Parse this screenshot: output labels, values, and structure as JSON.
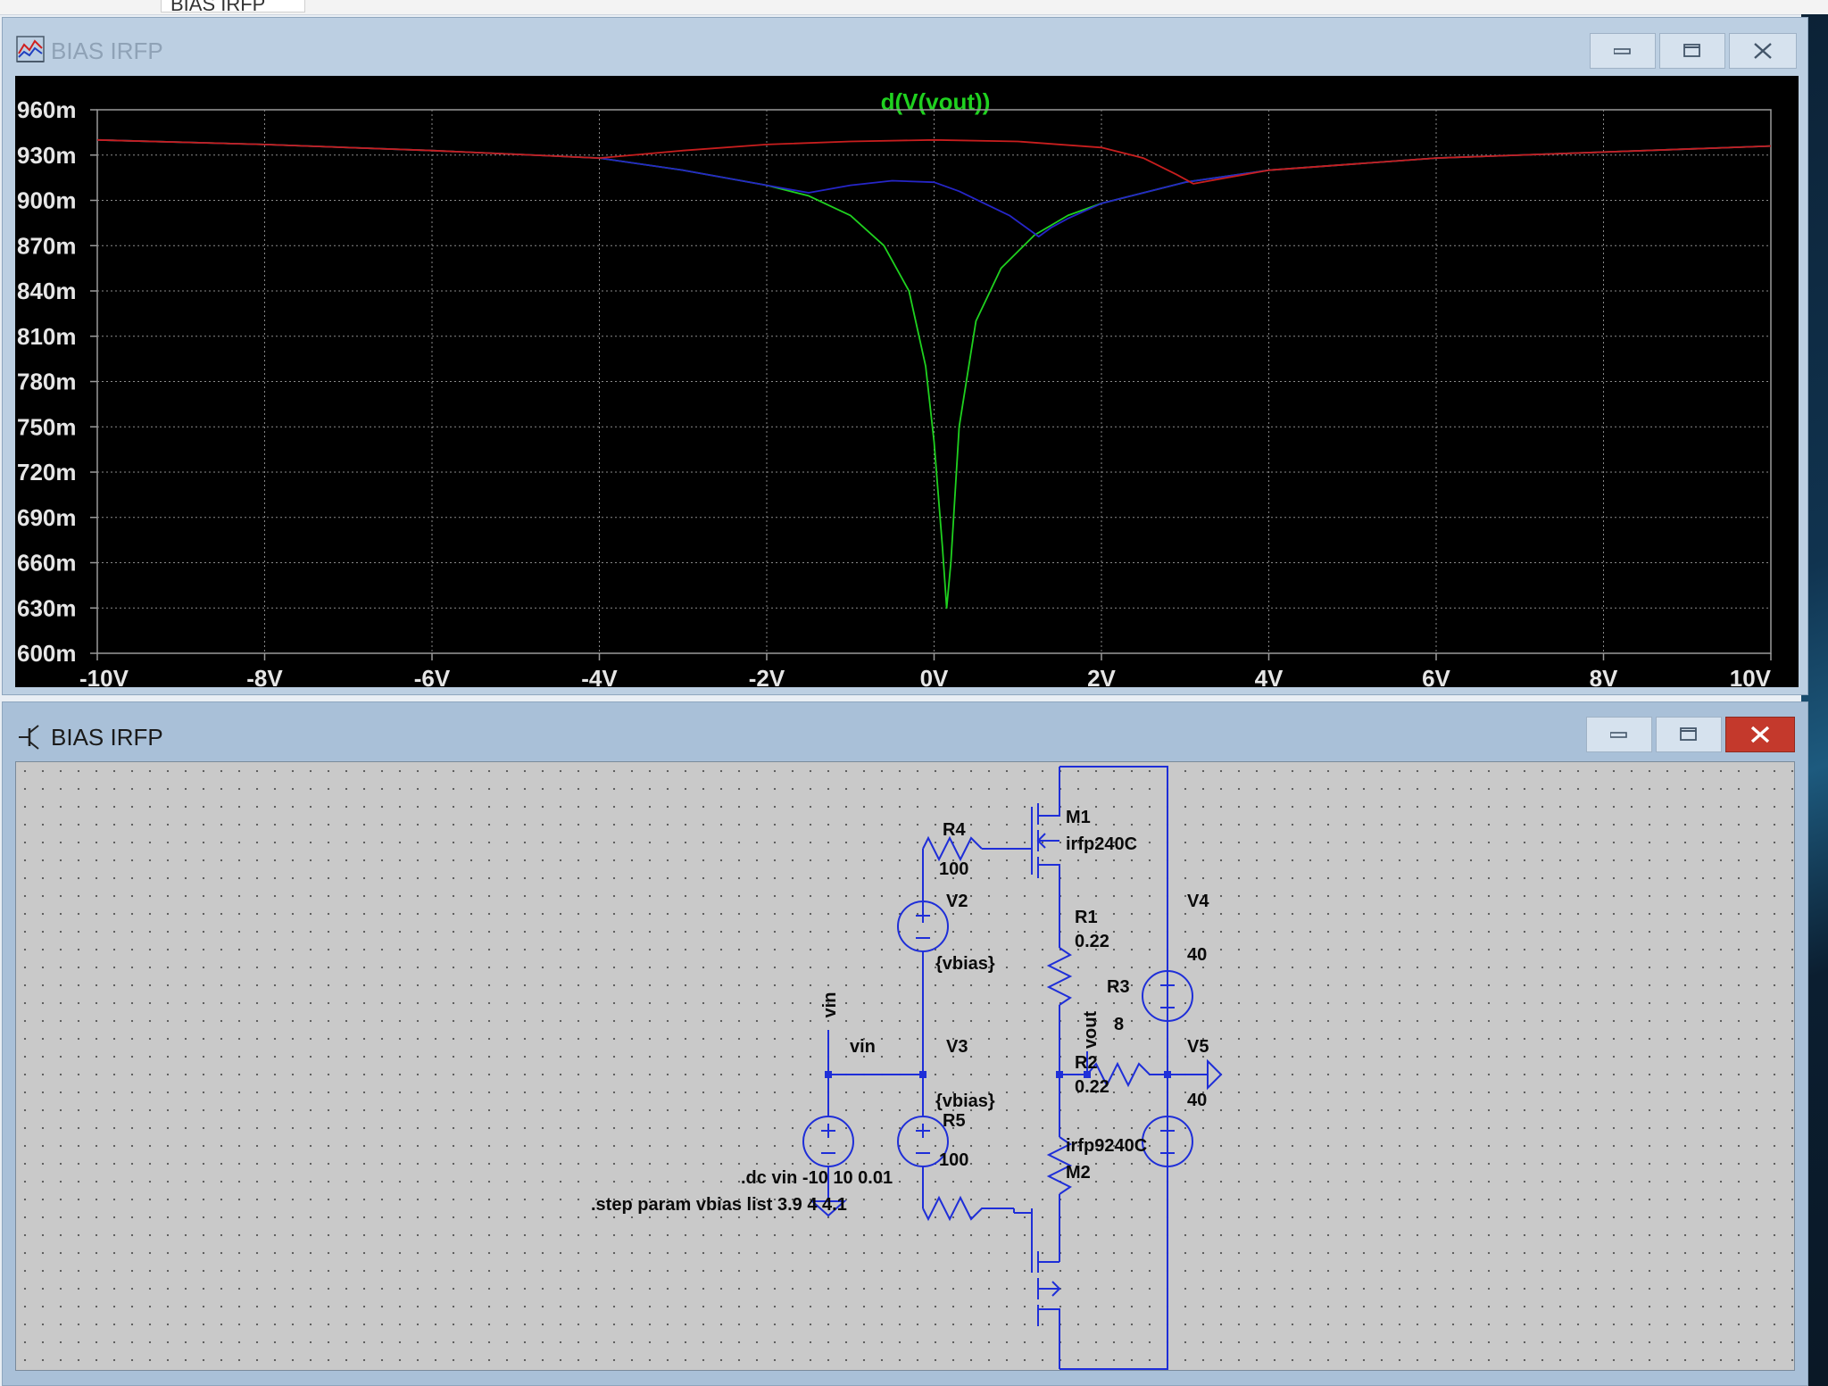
{
  "top_tab": {
    "label": "BIAS IRFP"
  },
  "plot_window": {
    "title": "BIAS IRFP",
    "plot_title": "d(V(vout))"
  },
  "schematic_window": {
    "title": "BIAS IRFP",
    "labels": {
      "m1_name": "M1",
      "m1_model": "irfp240C",
      "m2_name": "M2",
      "m2_model": "irfp9240C",
      "r4_name": "R4",
      "r4_value": "100",
      "r5_name": "R5",
      "r5_value": "100",
      "r1_name": "R1",
      "r1_value": "0.22",
      "r2_name": "R2",
      "r2_value": "0.22",
      "r3_name": "R3",
      "r3_value": "8",
      "v2_name": "V2",
      "v2_value": "{vbias}",
      "v3_name": "V3",
      "v3_value": "{vbias}",
      "v4_name": "V4",
      "v4_value": "40",
      "v5_name": "V5",
      "v5_value": "40",
      "vin_source": "vin",
      "vin_net": "vin",
      "vout_net": "vout"
    },
    "directives": {
      "dc": ".dc vin -10 10 0.01",
      "step": ".step param vbias list 3.9 4 4.1"
    }
  },
  "colors": {
    "plot_bg": "#000000",
    "trace_green": "#1fd11f",
    "trace_blue": "#2626c8",
    "trace_red": "#c81e1e",
    "schematic_wire": "#1e2ed8",
    "schematic_text": "#0a0a0a"
  },
  "chart_data": {
    "type": "line",
    "title": "d(V(vout))",
    "xlim": [
      -10,
      10
    ],
    "ylim": [
      0.6,
      0.96
    ],
    "x_ticks": [
      "-10V",
      "-8V",
      "-6V",
      "-4V",
      "-2V",
      "0V",
      "2V",
      "4V",
      "6V",
      "8V",
      "10V"
    ],
    "y_ticks": [
      "960m",
      "930m",
      "900m",
      "870m",
      "840m",
      "810m",
      "780m",
      "750m",
      "720m",
      "690m",
      "660m",
      "630m",
      "600m"
    ],
    "grid": true,
    "series": [
      {
        "color": "#1fd11f",
        "x": [
          -10,
          -8,
          -6,
          -4,
          -3,
          -2,
          -1.5,
          -1,
          -0.6,
          -0.3,
          -0.1,
          0,
          0.1,
          0.15,
          0.2,
          0.3,
          0.5,
          0.8,
          1.2,
          1.6,
          2,
          3,
          4,
          6,
          8,
          10
        ],
        "y": [
          0.94,
          0.937,
          0.933,
          0.928,
          0.92,
          0.91,
          0.903,
          0.89,
          0.87,
          0.84,
          0.79,
          0.74,
          0.67,
          0.63,
          0.66,
          0.75,
          0.82,
          0.855,
          0.877,
          0.89,
          0.898,
          0.912,
          0.92,
          0.928,
          0.932,
          0.936
        ]
      },
      {
        "color": "#2626c8",
        "x": [
          -10,
          -8,
          -6,
          -4,
          -3,
          -2,
          -1.5,
          -1,
          -0.5,
          0,
          0.3,
          0.6,
          0.9,
          1.1,
          1.25,
          1.4,
          1.6,
          2,
          3,
          4,
          6,
          8,
          10
        ],
        "y": [
          0.94,
          0.937,
          0.933,
          0.928,
          0.92,
          0.91,
          0.905,
          0.91,
          0.913,
          0.912,
          0.906,
          0.898,
          0.89,
          0.882,
          0.876,
          0.882,
          0.888,
          0.898,
          0.912,
          0.92,
          0.928,
          0.932,
          0.936
        ]
      },
      {
        "color": "#c81e1e",
        "x": [
          -10,
          -8,
          -6,
          -4,
          -3,
          -2,
          -1,
          0,
          1,
          2,
          2.5,
          2.9,
          3.1,
          3.5,
          4,
          6,
          8,
          10
        ],
        "y": [
          0.94,
          0.937,
          0.933,
          0.928,
          0.933,
          0.937,
          0.939,
          0.94,
          0.939,
          0.935,
          0.928,
          0.917,
          0.911,
          0.915,
          0.92,
          0.928,
          0.932,
          0.936
        ]
      }
    ]
  }
}
